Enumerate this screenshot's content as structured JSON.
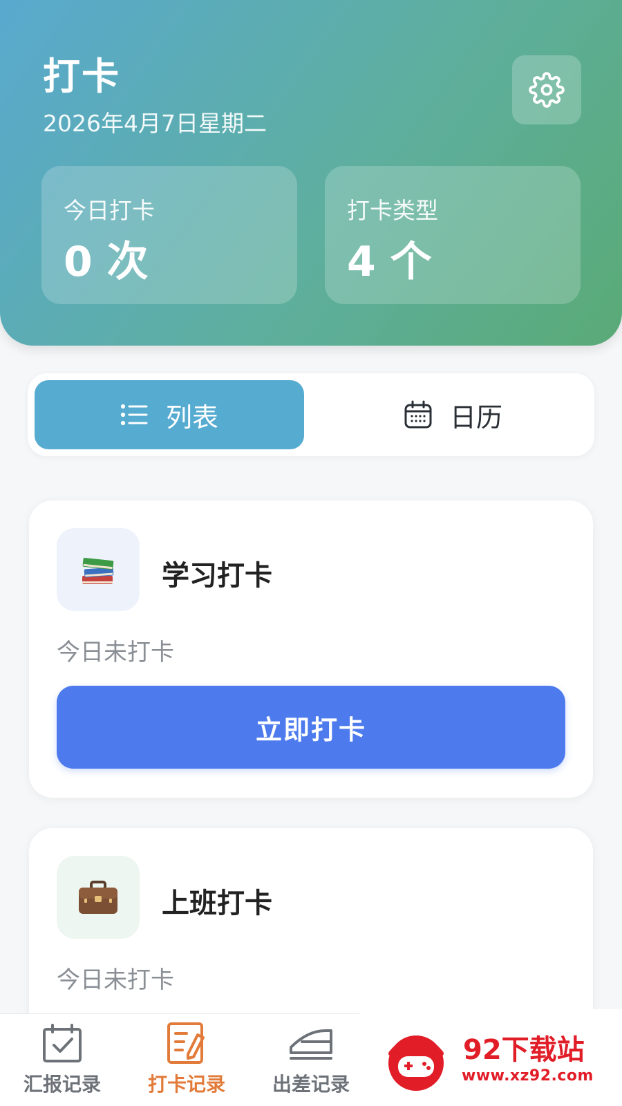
{
  "header": {
    "title": "打卡",
    "date": "2026年4月7日星期二",
    "stats": [
      {
        "label": "今日打卡",
        "value": "0 次"
      },
      {
        "label": "打卡类型",
        "value": "4 个"
      }
    ]
  },
  "view_toggle": {
    "list_label": "列表",
    "calendar_label": "日历",
    "selected": "列表"
  },
  "cards": [
    {
      "title": "学习打卡",
      "status": "今日未打卡",
      "button": "立即打卡",
      "icon": "books-icon"
    },
    {
      "title": "上班打卡",
      "status": "今日未打卡",
      "icon": "briefcase-icon"
    }
  ],
  "bottom_nav": [
    {
      "label": "汇报记录",
      "icon": "report-calendar-icon"
    },
    {
      "label": "打卡记录",
      "icon": "checkin-record-icon",
      "active": true
    },
    {
      "label": "出差记录",
      "icon": "train-icon"
    }
  ],
  "watermark": {
    "name": "92下载站",
    "url": "www.xz92.com"
  },
  "colors": {
    "header_gradient_start": "#59a9cf",
    "header_gradient_end": "#5aaa77",
    "primary_button": "#4d7bed",
    "toggle_active": "#56abd0",
    "nav_active": "#e27b39",
    "watermark_red": "#e11d28"
  }
}
